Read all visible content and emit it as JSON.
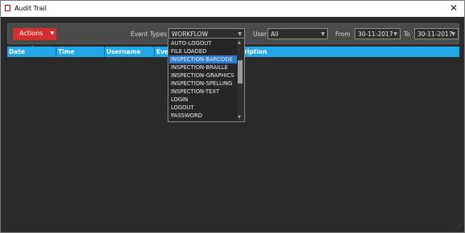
{
  "window": {
    "title": "Audit Trail",
    "close_glyph": "✕"
  },
  "toolbar": {
    "actions_label": "Actions",
    "event_types_label": "Event Types",
    "event_types_value": "WORKFLOW",
    "user_label": "User",
    "user_value": "All",
    "from_label": "From",
    "from_value": "30-11-2017",
    "to_label": "To",
    "to_value": "30-11-2017"
  },
  "grid": {
    "columns": [
      "Date",
      "Time",
      "Username",
      "Even",
      "ription"
    ]
  },
  "event_types_dropdown": {
    "items": [
      "AUTO-LOGOUT",
      "FILE LOADED",
      "INSPECTION-BARCODE",
      "INSPECTION-BRAILLE",
      "INSPECTION-GRAPHICS",
      "INSPECTION-SPELLING",
      "INSPECTION-TEXT",
      "LOGIN",
      "LOGOUT",
      "PASSWORD"
    ],
    "highlighted": "INSPECTION-BARCODE"
  },
  "icons": {
    "app": "audit-app-icon",
    "close": "close-icon",
    "dropdown_arrow": "chevron-down-icon",
    "scroll_up": "scroll-up-icon",
    "scroll_down": "scroll-down-icon"
  },
  "colors": {
    "actions_button": "#d32f2f",
    "grid_header": "#20a8e8",
    "selection": "#2a7fd4",
    "background": "#2b2b2b"
  }
}
